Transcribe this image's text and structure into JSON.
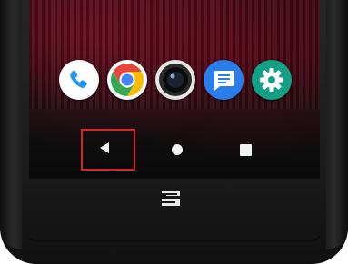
{
  "device": {
    "screen": {
      "dock_apps": [
        {
          "icon": "phone-icon",
          "color": "#2196f3"
        },
        {
          "icon": "chrome-icon",
          "color": "#e8453c"
        },
        {
          "icon": "camera-icon",
          "color": "#111111"
        },
        {
          "icon": "messages-icon",
          "color": "#2b7de9"
        },
        {
          "icon": "settings-icon",
          "color": "#14a085"
        }
      ],
      "nav_bar": {
        "buttons": [
          "back-icon",
          "home-icon",
          "recents-icon"
        ],
        "highlighted": "back-icon",
        "highlight_color": "#d8232a"
      }
    },
    "hardware_logo": "crosscall-logo"
  }
}
